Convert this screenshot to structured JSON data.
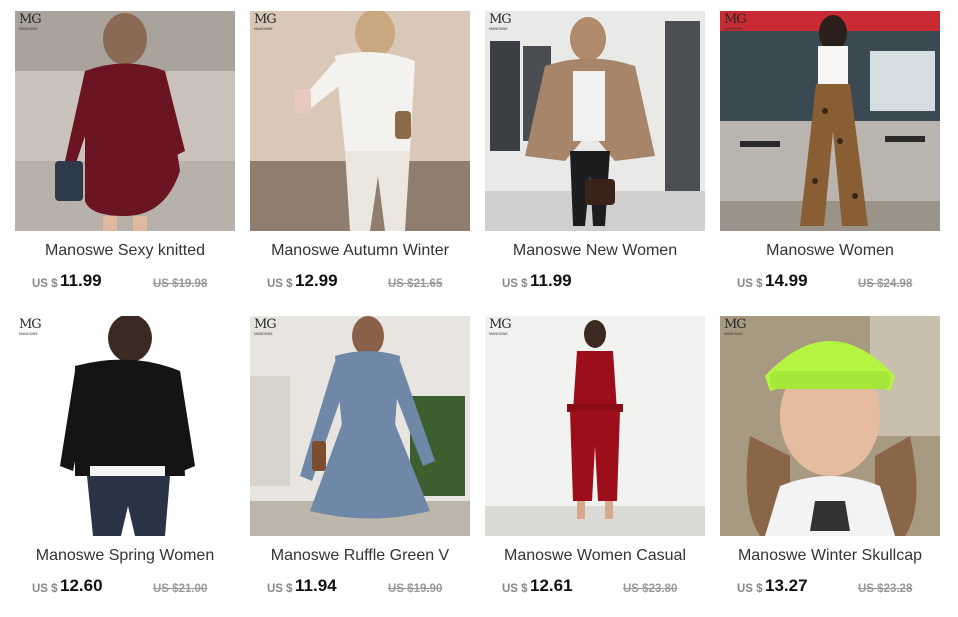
{
  "products": [
    {
      "title": "Manoswe Sexy knitted",
      "currency": "US $",
      "price": "11.99",
      "original_price": "US $19.98",
      "logo_mark": "MG",
      "logo_text": "MANOSWE"
    },
    {
      "title": "Manoswe Autumn Winter",
      "currency": "US $",
      "price": "12.99",
      "original_price": "US $21.65",
      "logo_mark": "MG",
      "logo_text": "MANOSWE"
    },
    {
      "title": "Manoswe New Women",
      "currency": "US $",
      "price": "11.99",
      "original_price": "",
      "logo_mark": "MG",
      "logo_text": "MANOSWE"
    },
    {
      "title": "Manoswe Women",
      "currency": "US $",
      "price": "14.99",
      "original_price": "US $24.98",
      "logo_mark": "MG",
      "logo_text": "MANOSWE"
    },
    {
      "title": "Manoswe Spring Women",
      "currency": "US $",
      "price": "12.60",
      "original_price": "US $21.00",
      "logo_mark": "MG",
      "logo_text": "MANOSWE"
    },
    {
      "title": "Manoswe Ruffle Green V",
      "currency": "US $",
      "price": "11.94",
      "original_price": "US $19.90",
      "logo_mark": "MG",
      "logo_text": "MANOSWE"
    },
    {
      "title": "Manoswe Women Casual",
      "currency": "US $",
      "price": "12.61",
      "original_price": "US $23.80",
      "logo_mark": "MG",
      "logo_text": "MANOSWE"
    },
    {
      "title": "Manoswe Winter Skullcap",
      "currency": "US $",
      "price": "13.27",
      "original_price": "US $23.28",
      "logo_mark": "MG",
      "logo_text": "MANOSWE"
    }
  ]
}
